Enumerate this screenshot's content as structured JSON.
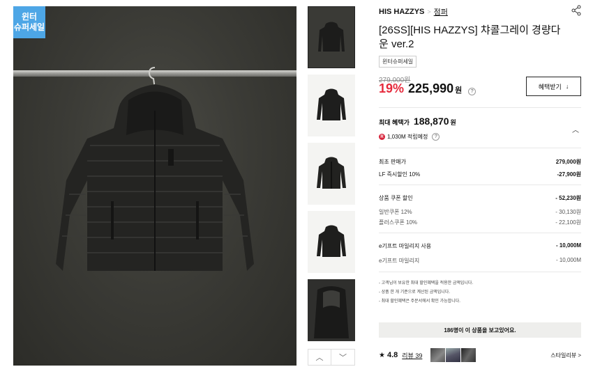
{
  "badge": {
    "line1": "윈터",
    "line2": "슈퍼세일"
  },
  "breadcrumb": {
    "brand": "HIS HAZZYS",
    "separator": ">",
    "shop": "점퍼"
  },
  "product": {
    "title": "[26SS][HIS HAZZYS] 챠콜그레이 경량다운 ver.2",
    "tag": "윈터슈퍼세일",
    "original_price": "279,000원",
    "discount": "19%",
    "price": "225,990",
    "price_unit": "원",
    "help": "?"
  },
  "benefit_button": {
    "label": "혜택받기",
    "icon": "↓"
  },
  "max_benefit": {
    "label": "최대 혜택가",
    "value": "188,870",
    "unit": "원",
    "points_badge": "R",
    "points": "1,030M 적립예정"
  },
  "breakdown": [
    {
      "label": "최초 판매가",
      "value": "279,000원",
      "sub": false
    },
    {
      "label": "LF 즉시할인 10%",
      "value": "-27,900원",
      "sub": false
    },
    {
      "label": "상품 쿠폰 할인",
      "value": "- 52,230원",
      "sub": false
    },
    {
      "label": "일반쿠폰 12%",
      "value": "- 30,130원",
      "sub": true
    },
    {
      "label": "플러스쿠폰 10%",
      "value": "- 22,100원",
      "sub": true
    },
    {
      "label": "e기프트 마일리지 사용",
      "value": "- 10,000M",
      "sub": false
    },
    {
      "label": "e기프트 마일리지",
      "value": "- 10,000M",
      "sub": true
    }
  ],
  "notes": [
    "- 고객님이 보유한 최대 할인혜택을 적용한 금액입니다.",
    "- 상품 한 개 기준으로 계산된 금액입니다.",
    "- 최대 할인혜택은 주문서에서 확인 가능합니다."
  ],
  "viewers": "186명이 이 상품을 보고있어요.",
  "reviews": {
    "star": "★",
    "rating": "4.8",
    "link": "리뷰 39",
    "style_review": "스타일리뷰 >"
  },
  "thumb_nav": {
    "up": "︿",
    "down": "﹀"
  },
  "colors": {
    "discount": "#e62a3c",
    "badge": "#4da6e6",
    "jacket": "#2a2a28"
  }
}
